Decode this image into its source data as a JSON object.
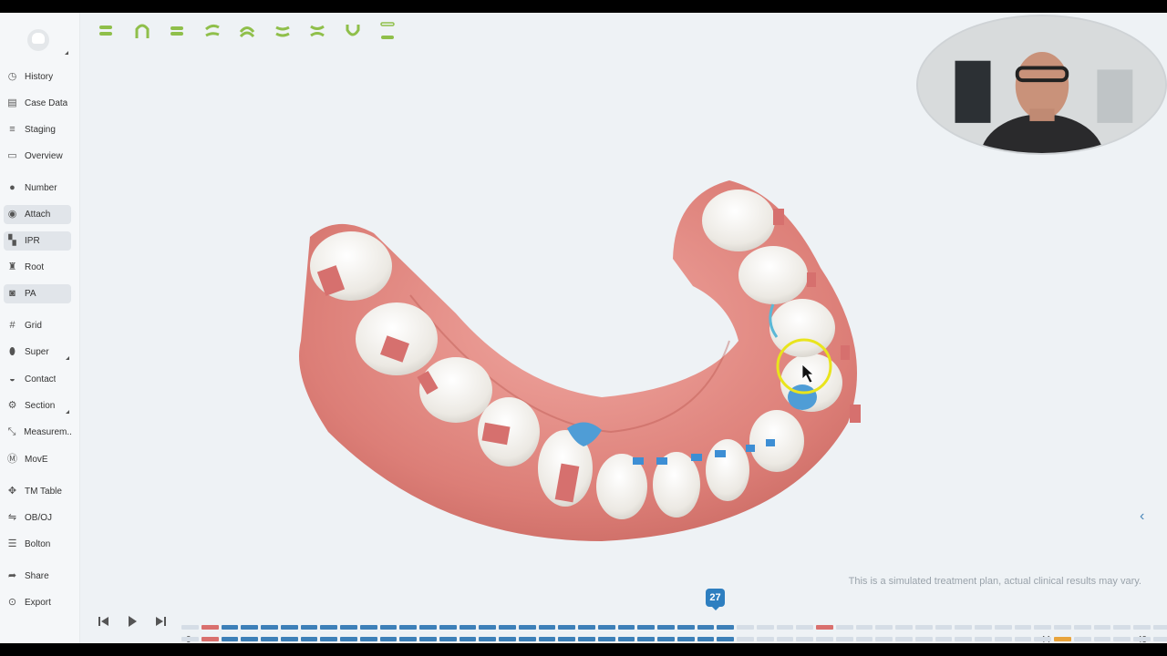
{
  "sidebar": {
    "items": [
      {
        "label": "History",
        "icon": "history-icon",
        "glyph": "◷"
      },
      {
        "label": "Case Data",
        "icon": "case-data-icon",
        "glyph": "▤"
      },
      {
        "label": "Staging",
        "icon": "staging-icon",
        "glyph": "≡"
      },
      {
        "label": "Overview",
        "icon": "overview-icon",
        "glyph": "▭"
      },
      {
        "label": "Number",
        "icon": "number-icon",
        "glyph": "●"
      },
      {
        "label": "Attach",
        "icon": "attach-icon",
        "glyph": "◉"
      },
      {
        "label": "IPR",
        "icon": "ipr-icon",
        "glyph": "▚"
      },
      {
        "label": "Root",
        "icon": "root-icon",
        "glyph": "♜"
      },
      {
        "label": "PA",
        "icon": "pa-icon",
        "glyph": "◙"
      },
      {
        "label": "Grid",
        "icon": "grid-icon",
        "glyph": "#"
      },
      {
        "label": "Super",
        "icon": "super-icon",
        "glyph": "⬮"
      },
      {
        "label": "Contact",
        "icon": "contact-icon",
        "glyph": "◒"
      },
      {
        "label": "Section",
        "icon": "section-icon",
        "glyph": "⚙"
      },
      {
        "label": "Measurem...",
        "icon": "measurement-icon",
        "glyph": "⤡"
      },
      {
        "label": "MovE",
        "icon": "move-icon",
        "glyph": "Ⓜ"
      },
      {
        "label": "TM Table",
        "icon": "tm-table-icon",
        "glyph": "✥"
      },
      {
        "label": "OB/OJ",
        "icon": "ob-oj-icon",
        "glyph": "⇋"
      },
      {
        "label": "Bolton",
        "icon": "bolton-icon",
        "glyph": "☰"
      },
      {
        "label": "Share",
        "icon": "share-icon",
        "glyph": "➦"
      },
      {
        "label": "Export",
        "icon": "export-icon",
        "glyph": "⊙"
      }
    ]
  },
  "toolbar": {
    "tools": [
      "both-jaws-view-icon",
      "upper-arch-view-icon",
      "front-view-icon",
      "right-view-icon",
      "top-view-icon",
      "left-view-icon",
      "bite-view-icon",
      "lower-arch-view-icon",
      "separate-jaws-view-icon"
    ],
    "accent": "#8fbf4a"
  },
  "viewer": {
    "disclaimer": "This is a simulated treatment plan, actual clinical results may vary."
  },
  "timeline": {
    "current_stage": "27",
    "start_label": "0",
    "mid_label": "44",
    "end_label": "49",
    "total_stages": 49,
    "current_value": 27,
    "mid_value": 44,
    "colors": {
      "done": "#3d80b8",
      "pending": "#d5dde6",
      "marker": "#d9706e",
      "orange": "#e8a43c"
    }
  }
}
